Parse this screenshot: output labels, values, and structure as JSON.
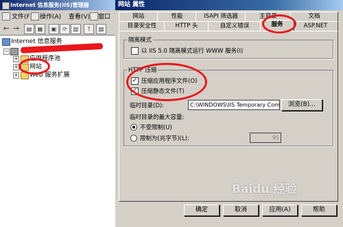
{
  "iis": {
    "title": "Internet 信息服务(IIS)管理器",
    "menu": [
      "文件(F)",
      "操作(A)",
      "查看(V)",
      "窗口"
    ],
    "tree": {
      "root": "Internet 信息服务",
      "items": [
        "应用程序池",
        "网站",
        "Web 服务扩展"
      ]
    }
  },
  "dialog": {
    "title": "网站 属性",
    "tabs_back": [
      "网站",
      "性能",
      "ISAPI 筛选器",
      "主目录",
      "文档"
    ],
    "tabs_front": [
      "目录安全性",
      "HTTP 头",
      "自定义错误",
      "服务",
      "ASP.NET"
    ],
    "isolation": {
      "group_label": "隔离模式",
      "checkbox_label": "以 IIS 5.0 隔离模式运行 WWW 服务(I)",
      "checked": false
    },
    "compression": {
      "group_label": "HTTP 压缩",
      "app_files_label": "压缩应用程序文件(O)",
      "app_files_checked": true,
      "static_files_label": "压缩静态文件(T)",
      "static_files_checked": true,
      "temp_dir_label": "临时目录(D):",
      "temp_dir_value": "C:\\WINDOWS\\IIS Temporary Compr",
      "browse_label": "浏览(B)...",
      "max_size_label": "临时目录的最大容量:",
      "unlimited_label": "不受限制(U)",
      "limited_label": "限制为(兆字节)(L):",
      "limit_value": "95",
      "selected": "unlimited"
    },
    "buttons": {
      "ok": "确定",
      "cancel": "取消",
      "apply": "应用(A)",
      "help": "帮助"
    }
  },
  "watermark": {
    "text": "Baidu 经验",
    "sub": "jingyan.baidu.com"
  },
  "colors": {
    "title_bar": "#0a246a",
    "annotation": "#e8171b",
    "face": "#d4d0c8"
  }
}
